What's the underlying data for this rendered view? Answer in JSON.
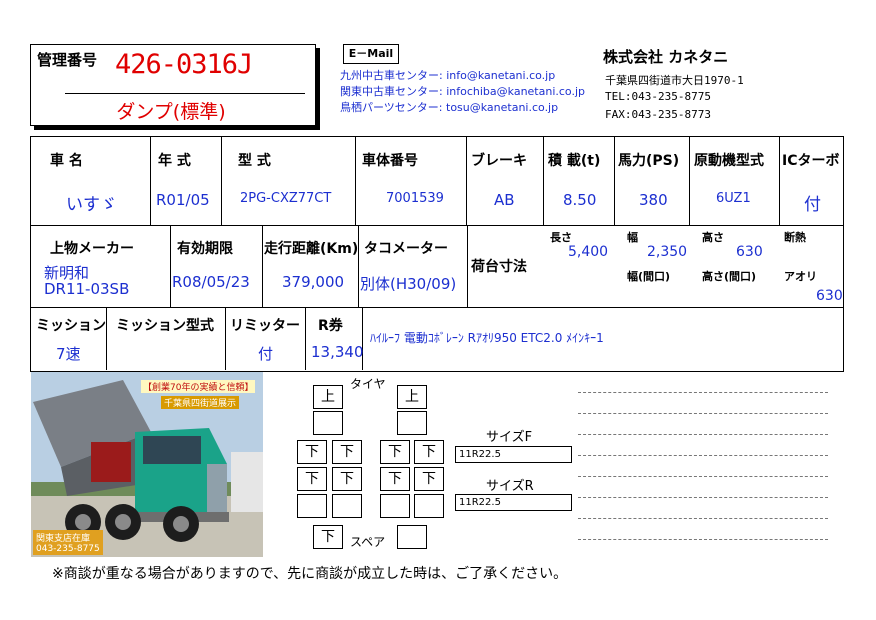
{
  "management": {
    "label": "管理番号",
    "number": "426-0316J",
    "vehicle_type": "ダンプ(標準)"
  },
  "email": {
    "box_label": "E－Mail",
    "rows": [
      {
        "label": "九州中古車センター:",
        "address": "info@kanetani.co.jp"
      },
      {
        "label": "関東中古車センター:",
        "address": "infochiba@kanetani.co.jp"
      },
      {
        "label": "鳥栖パーツセンター:",
        "address": "tosu@kanetani.co.jp"
      }
    ]
  },
  "company": {
    "name": "株式会社 カネタニ",
    "address": "千葉県四街道市大日1970-1",
    "tel": "TEL:043-235-8775",
    "fax": "FAX:043-235-8773"
  },
  "row1": {
    "headers": [
      "車 名",
      "年 式",
      "型 式",
      "車体番号",
      "ブレーキ",
      "積 載(t)",
      "馬力(PS)",
      "原動機型式",
      "ICターボ"
    ],
    "values": [
      "いすゞ",
      "R01/05",
      "2PG-CXZ77CT",
      "7001539",
      "AB",
      "8.50",
      "380",
      "6UZ1",
      "付"
    ]
  },
  "row2": {
    "headers": [
      "上物メーカー",
      "有効期限",
      "走行距離(Km)",
      "タコメーター"
    ],
    "maker_line1": "新明和",
    "maker_line2": "DR11-03SB",
    "expiry": "R08/05/23",
    "mileage": "379,000",
    "tacho": "別体(H30/09)",
    "cargo_label": "荷台寸法",
    "length_label": "長さ",
    "length": "5,400",
    "width_label": "幅",
    "width": "2,350",
    "height_label": "高さ",
    "height": "630",
    "insulation_label": "断熱",
    "inner_width_label": "幅(間口)",
    "inner_height_label": "高さ(間口)",
    "aori_label": "アオリ",
    "aori": "630"
  },
  "row3": {
    "headers": [
      "ミッション",
      "ミッション型式",
      "リミッター",
      "R券"
    ],
    "mission": "7速",
    "mission_type": "",
    "limiter": "付",
    "r_ken": "13,340",
    "options": "ﾊｲﾙｰﾌ 電動ｺﾎﾞﾚｰﾝ Rｱｵﾘ950 ETC2.0 ﾒｲﾝｷｰ1"
  },
  "photo": {
    "banner1": "【創業70年の実績と信頼】",
    "banner2": "千葉県四街道展示",
    "footer1": "関東支店在庫",
    "footer2": "043-235-8775"
  },
  "tires": {
    "tire_label": "タイヤ",
    "up": "上",
    "down": "下",
    "spare_label": "スペア",
    "size_f_label": "サイズF",
    "size_f": "11R22.5",
    "size_r_label": "サイズR",
    "size_r": "11R22.5"
  },
  "footer_note": "※商談が重なる場合がありますので、先に商談が成立した時は、ご了承ください。",
  "colors": {
    "accent_red": "#e00000",
    "accent_blue": "#1c2fd0"
  }
}
